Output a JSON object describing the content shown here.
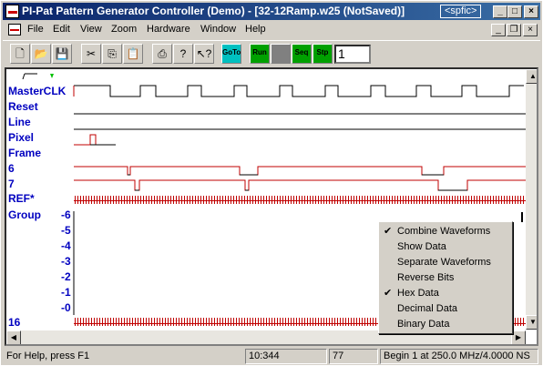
{
  "window": {
    "title": "PI-Pat Pattern Generator Controller (Demo) - [32-12Ramp.w25 (NotSaved)]",
    "tag": "<spfic>",
    "controls": {
      "minimize": "_",
      "maximize": "□",
      "close": "×"
    }
  },
  "menubar": {
    "items": [
      "File",
      "Edit",
      "View",
      "Zoom",
      "Hardware",
      "Window",
      "Help"
    ],
    "mdi_controls": {
      "minimize": "_",
      "restore": "❐",
      "close": "×"
    }
  },
  "toolbar": {
    "buttons": [
      "new",
      "open",
      "save",
      "cut",
      "copy",
      "paste",
      "print",
      "help",
      "context-help"
    ],
    "goto_label": "GoTo",
    "run_label": "Run",
    "seq_label": "Seq",
    "step_label": "Stp",
    "step_value": "1",
    "colors": {
      "goto": "#00c0c0",
      "run": "#00a000",
      "stop": "#808080",
      "seq": "#00a000",
      "step": "#00a000"
    }
  },
  "signals": [
    "MasterCLK",
    "Reset",
    "Line",
    "Pixel",
    "Frame",
    "6",
    "7",
    "REF*",
    "Group",
    "16"
  ],
  "group_axis": [
    "-6",
    "-5",
    "-4",
    "-3",
    "-2",
    "-1",
    "-0"
  ],
  "context_menu": {
    "items": [
      {
        "label": "Combine Waveforms",
        "checked": true
      },
      {
        "label": "Show Data",
        "checked": false
      },
      {
        "label": "Separate Waveforms",
        "checked": false
      },
      {
        "label": "Reverse Bits",
        "checked": false
      },
      {
        "label": "Hex Data",
        "checked": true
      },
      {
        "label": "Decimal Data",
        "checked": false
      },
      {
        "label": "Binary Data",
        "checked": false
      }
    ]
  },
  "statusbar": {
    "help": "For Help, press F1",
    "position": "10:344",
    "count": "77",
    "info": "Begin 1 at 250.0 MHz/4.0000 NS"
  },
  "colors": {
    "signal_label": "#0000c0",
    "trace_red": "#c00000",
    "trace_black": "#000000",
    "title_start": "#0a246a"
  }
}
